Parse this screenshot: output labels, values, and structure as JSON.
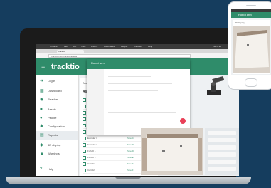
{
  "browser": {
    "tab_title": "tracktio",
    "url": "tracktio.com/tracktio/assets",
    "menu": [
      "Chrome",
      "File",
      "Edit",
      "View",
      "History",
      "Bookmarks",
      "People",
      "Window",
      "Help"
    ],
    "clock": "Sat 8:26"
  },
  "app": {
    "logo": "tracktio",
    "sidebar": [
      {
        "label": "Log in",
        "icon": "login-icon"
      },
      {
        "label": "Dashboard",
        "icon": "dashboard-icon"
      },
      {
        "label": "Readers",
        "icon": "reader-icon"
      },
      {
        "label": "Assets",
        "icon": "asset-icon"
      },
      {
        "label": "People",
        "icon": "people-icon"
      },
      {
        "label": "Configuration",
        "icon": "gear-icon"
      },
      {
        "label": "Reports",
        "icon": "report-icon"
      },
      {
        "label": "3D display",
        "icon": "cube-icon"
      },
      {
        "label": "Warnings",
        "icon": "warning-icon"
      },
      {
        "label": "Help",
        "icon": "help-icon"
      }
    ],
    "active_item": "Reports",
    "main": {
      "header": "Assets",
      "list_title": "Assets",
      "rows": [
        {
          "name": "Name",
          "link": ""
        },
        {
          "name": "Pneumatic pump 1",
          "link": "Zone A"
        },
        {
          "name": "Pneumatic pump 2",
          "link": "Zone A"
        },
        {
          "name": "Pneumatic pump 3",
          "link": "Zone B"
        },
        {
          "name": "Robot arm 1",
          "link": "Zone B"
        },
        {
          "name": "Robot arm 2",
          "link": "Zone C"
        },
        {
          "name": "Extruder 1",
          "link": "Zone C"
        },
        {
          "name": "Extruder 2",
          "link": "Zone D"
        },
        {
          "name": "Forklift 1",
          "link": "Zone D"
        },
        {
          "name": "Forklift 2",
          "link": "Zone E"
        },
        {
          "name": "Cart 01",
          "link": "Zone E"
        },
        {
          "name": "Cart 02",
          "link": "Zone F"
        }
      ]
    },
    "dialog": {
      "title": "Robot arm"
    }
  },
  "phone": {
    "title": "Robot arm",
    "card_label": "3D display"
  },
  "colors": {
    "background": "#153d5e",
    "brand": "#2f8c6a",
    "accent": "#e94057"
  }
}
